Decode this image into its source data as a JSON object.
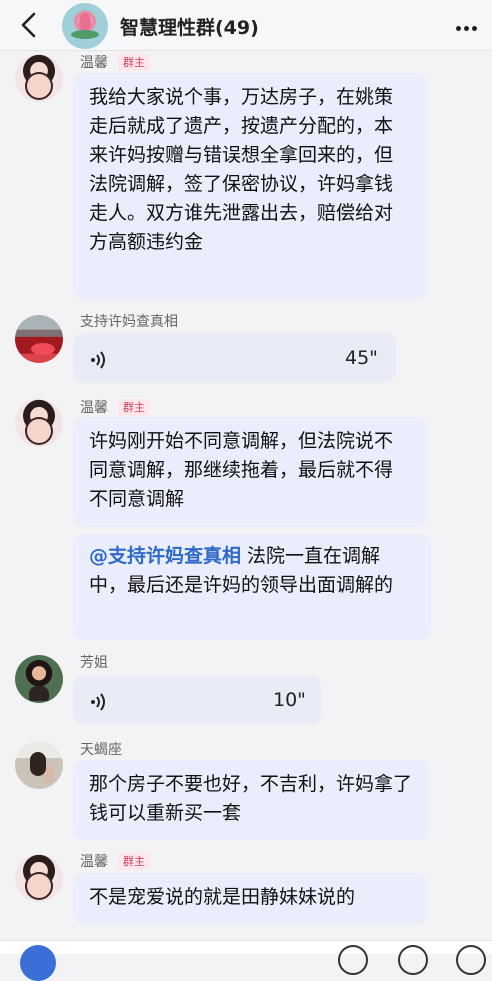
{
  "header": {
    "title": "智慧理性群(49)"
  },
  "messages": [
    {
      "sender": "温馨",
      "badge": "群主",
      "text": "我给大家说个事，万达房子，在姚策走后就成了遗产，按遗产分配的，本来许妈按赠与错误想全拿回来的，但法院调解，签了保密协议，许妈拿钱走人。双方谁先泄露出去，赔偿给对方高额违约金"
    },
    {
      "sender": "支持许妈查真相",
      "voice_duration": "45\""
    },
    {
      "sender": "温馨",
      "badge": "群主",
      "text": "许妈刚开始不同意调解，但法院说不同意调解，那继续拖着，最后就不得不同意调解",
      "followup_mention": "@支持许妈查真相",
      "followup_text": " 法院一直在调解中，最后还是许妈的领导出面调解的"
    },
    {
      "sender": "芳姐",
      "voice_duration": "10\""
    },
    {
      "sender": "天蝎座",
      "text": "那个房子不要也好，不吉利，许妈拿了钱可以重新买一套"
    },
    {
      "sender": "温馨",
      "badge": "群主",
      "text": "不是宠爱说的就是田静妹妹说的"
    }
  ],
  "icons": {
    "back": "back-chevron-icon",
    "more": "more-dots-icon",
    "voice": "voice-wave-icon"
  },
  "colors": {
    "bubble": "#eaedfb",
    "badge_text": "#d23f5c",
    "badge_bg": "#fde6ec",
    "mention": "#2e69c9"
  }
}
